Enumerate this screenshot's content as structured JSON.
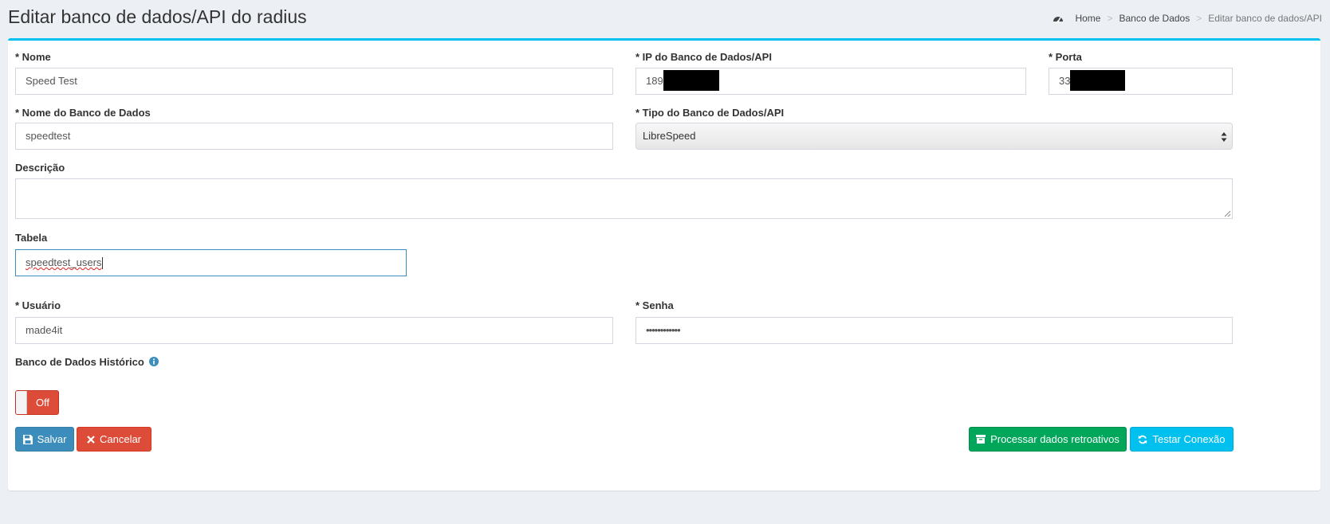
{
  "header": {
    "title": "Editar banco de dados/API do radius",
    "breadcrumb": {
      "home": "Home",
      "section": "Banco de Dados",
      "current": "Editar banco de dados/API"
    }
  },
  "form": {
    "nome": {
      "label": "* Nome",
      "value": "Speed Test"
    },
    "ip": {
      "label": "* IP do Banco de Dados/API",
      "value_visible": "189"
    },
    "porta": {
      "label": "* Porta",
      "value_visible": "33"
    },
    "nome_banco": {
      "label": "* Nome do Banco de Dados",
      "value": "speedtest"
    },
    "tipo": {
      "label": "* Tipo do Banco de Dados/API",
      "value": "LibreSpeed"
    },
    "descricao": {
      "label": "Descrição",
      "value": ""
    },
    "tabela": {
      "label": "Tabela",
      "value": "speedtest_users"
    },
    "usuario": {
      "label": "* Usuário",
      "value": "made4it"
    },
    "senha": {
      "label": "* Senha",
      "value": "••••••••••••"
    },
    "historico": {
      "label": "Banco de Dados Histórico",
      "toggle_text": "Off"
    }
  },
  "buttons": {
    "save": "Salvar",
    "cancel": "Cancelar",
    "process": "Processar dados retroativos",
    "test": "Testar Conexão"
  },
  "icons": {
    "breadcrumb": "dashboard-icon",
    "select": "select-arrows-icon",
    "info": "info-icon",
    "save": "floppy-disk-icon",
    "cancel": "close-icon",
    "process": "archive-icon",
    "test": "refresh-icon"
  },
  "colors": {
    "box_accent": "#00c0ef",
    "primary": "#3c8dbc",
    "danger": "#dd4b39",
    "success": "#00a65a",
    "info": "#00c0ef"
  }
}
